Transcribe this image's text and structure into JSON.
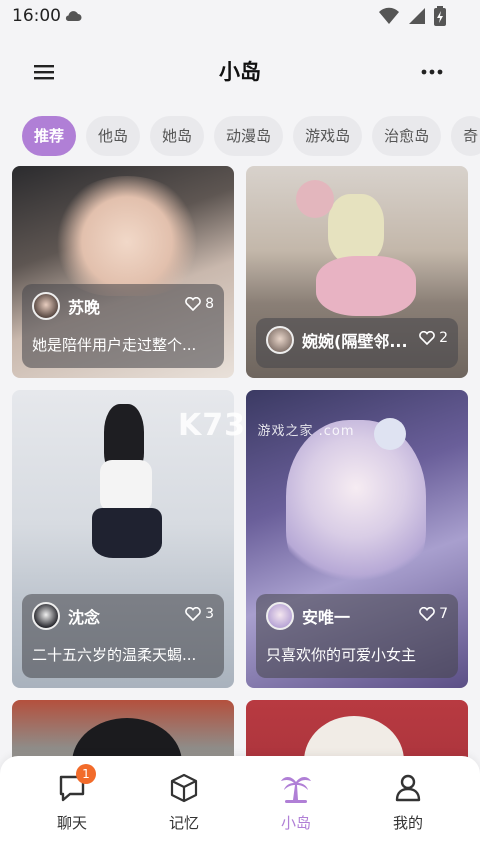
{
  "status": {
    "time": "16:00"
  },
  "header": {
    "title": "小岛"
  },
  "tabs": [
    "推荐",
    "他岛",
    "她岛",
    "动漫岛",
    "游戏岛",
    "治愈岛",
    "奇"
  ],
  "cards": [
    {
      "name": "苏晚",
      "likes": "8",
      "desc": "她是陪伴用户走过整个..."
    },
    {
      "name": "婉婉(隔壁邻...",
      "likes": "2",
      "desc": ""
    },
    {
      "name": "沈念",
      "likes": "3",
      "desc": "二十五六岁的温柔天蝎..."
    },
    {
      "name": "安唯一",
      "likes": "7",
      "desc": "只喜欢你的可爱小女主"
    }
  ],
  "watermark": {
    "main": "K73",
    "sub": "游戏之家 .com"
  },
  "nav": {
    "chat": {
      "label": "聊天",
      "badge": "1"
    },
    "memory": {
      "label": "记忆"
    },
    "island": {
      "label": "小岛"
    },
    "me": {
      "label": "我的"
    }
  },
  "colors": {
    "accent": "#b07fd6",
    "badge": "#f26b2a"
  }
}
